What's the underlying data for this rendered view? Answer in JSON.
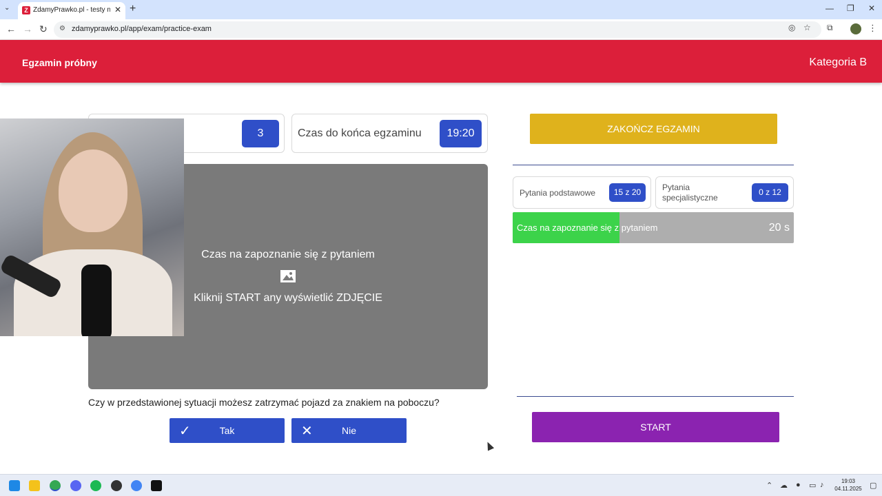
{
  "browser": {
    "tab_title": "ZdamyPrawko.pl - testy na pra",
    "tab_favicon_letter": "Z",
    "url": "zdamyprawko.pl/app/exam/practice-exam"
  },
  "header": {
    "title": "Egzamin próbny",
    "category": "Kategoria B"
  },
  "exam": {
    "question_number": "3",
    "time_label": "Czas do końca egzaminu",
    "time_value": "19:20",
    "media_line1": "Czas na zapoznanie się z pytaniem",
    "media_line2": "Kliknij START any wyświetlić ZDJĘCIE",
    "question_text": "Czy w przedstawionej sytuacji możesz zatrzymać pojazd za znakiem na poboczu?",
    "answers": [
      {
        "label": "Tak",
        "icon": "check-icon"
      },
      {
        "label": "Nie",
        "icon": "x-icon"
      }
    ]
  },
  "sidebar": {
    "end_button": "ZAKOŃCZ EGZAMIN",
    "basic_label": "Pytania podstawowe",
    "basic_value": "15 z 20",
    "special_label_line1": "Pytania",
    "special_label_line2": "specjalistyczne",
    "special_value": "0 z 12",
    "timer_label": "Czas na zapoznanie się z pytaniem",
    "timer_seconds": "20 s",
    "timer_progress": 0.38,
    "start_button": "START"
  },
  "taskbar": {
    "time": "19:03",
    "date": "04.11.2025"
  },
  "colors": {
    "brand_red": "#dc1f3a",
    "accent_blue": "#2f4fc8",
    "end_yellow": "#dfb21c",
    "start_purple": "#8b23b0",
    "timer_green": "#3cd34a"
  }
}
